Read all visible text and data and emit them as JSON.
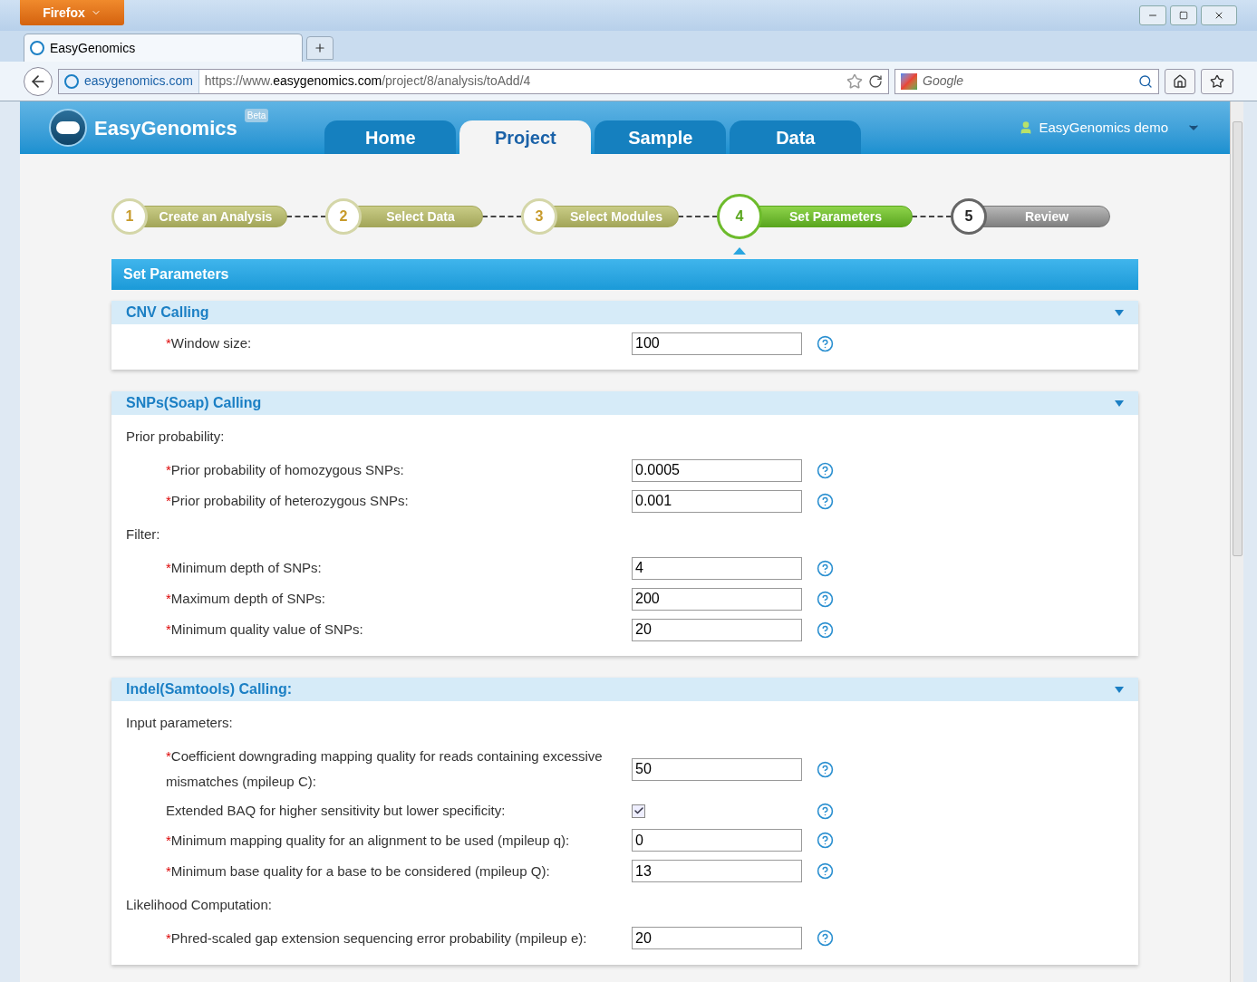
{
  "browser": {
    "menu_button": "Firefox",
    "tab": {
      "title": "EasyGenomics",
      "selected": true
    },
    "site_badge": "easygenomics.com",
    "url_prefix": "https://www.",
    "url_domain": "easygenomics.com",
    "url_path": "/project/8/analysis/toAdd/4",
    "search_placeholder": "Google"
  },
  "site": {
    "logo": "EasyGenomics",
    "beta": "Beta",
    "nav": [
      {
        "label": "Home",
        "selected": false
      },
      {
        "label": "Project",
        "selected": true
      },
      {
        "label": "Sample",
        "selected": false
      },
      {
        "label": "Data",
        "selected": false
      }
    ],
    "user": "EasyGenomics demo"
  },
  "steps": [
    {
      "number": "1",
      "label": "Create an Analysis",
      "completed": true,
      "selected": false
    },
    {
      "number": "2",
      "label": "Select Data",
      "completed": true,
      "selected": false
    },
    {
      "number": "3",
      "label": "Select Modules",
      "completed": true,
      "selected": false
    },
    {
      "number": "4",
      "label": "Set Parameters",
      "completed": false,
      "selected": true
    },
    {
      "number": "5",
      "label": "Review",
      "completed": false,
      "selected": false
    }
  ],
  "panel_title": "Set Parameters",
  "sections": [
    {
      "title": "CNV Calling",
      "expanded": true,
      "rows": [
        {
          "kind": "field",
          "marker": "*",
          "label": "Window size:",
          "value": "100"
        }
      ]
    },
    {
      "title": "SNPs(Soap) Calling",
      "expanded": true,
      "rows": [
        {
          "kind": "group",
          "label": "Prior probability:"
        },
        {
          "kind": "field",
          "marker": "*",
          "label": "Prior probability of homozygous SNPs:",
          "value": "0.0005"
        },
        {
          "kind": "field",
          "marker": "*",
          "label": "Prior probability of heterozygous SNPs:",
          "value": "0.001"
        },
        {
          "kind": "group",
          "label": "Filter:"
        },
        {
          "kind": "field",
          "marker": "*",
          "label": "Minimum depth of SNPs:",
          "value": "4"
        },
        {
          "kind": "field",
          "marker": "*",
          "label": "Maximum depth of SNPs:",
          "value": "200"
        },
        {
          "kind": "field",
          "marker": "*",
          "label": "Minimum quality value of SNPs:",
          "value": "20"
        }
      ]
    },
    {
      "title": "Indel(Samtools) Calling:",
      "expanded": true,
      "rows": [
        {
          "kind": "group",
          "label": "Input parameters:"
        },
        {
          "kind": "field",
          "marker": "*",
          "label": "Coefficient downgrading mapping quality for reads containing excessive mismatches (mpileup C):",
          "value": "50"
        },
        {
          "kind": "checkbox",
          "label": "Extended BAQ for higher sensitivity but lower specificity:",
          "checked": true
        },
        {
          "kind": "field",
          "marker": "*",
          "label": "Minimum mapping quality for an alignment to be used (mpileup q):",
          "value": "0"
        },
        {
          "kind": "field",
          "marker": "*",
          "label": "Minimum base quality for a base to be considered (mpileup Q):",
          "value": "13"
        },
        {
          "kind": "group",
          "label": "Likelihood Computation:"
        },
        {
          "kind": "field",
          "marker": "*",
          "label": "Phred-scaled gap extension sequencing error probability (mpileup e):",
          "value": "20"
        }
      ]
    }
  ]
}
